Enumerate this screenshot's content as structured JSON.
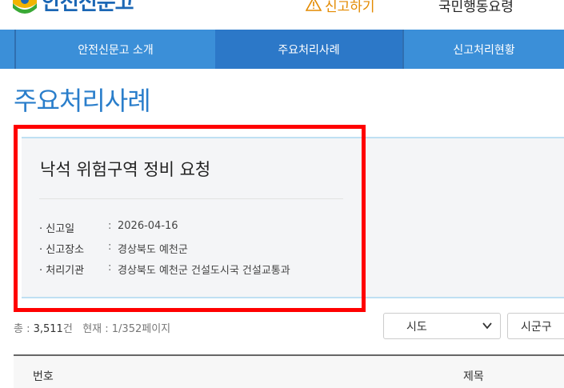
{
  "header": {
    "logo_text": "안전신문고",
    "report_label": "신고하기",
    "other_label": "국민행동요령"
  },
  "nav": {
    "items": [
      {
        "label": "안전신문고 소개"
      },
      {
        "label": "주요처리사례"
      },
      {
        "label": "신고처리현황"
      }
    ]
  },
  "page": {
    "title": "주요처리사례"
  },
  "case": {
    "title": "낙석 위험구역 정비 요청",
    "fields": [
      {
        "label": "· 신고일",
        "value": "2026-04-16"
      },
      {
        "label": "· 신고장소",
        "value": "경상북도 예천군"
      },
      {
        "label": "· 처리기관",
        "value": "경상북도 예천군 건설도시국 건설교통과"
      }
    ]
  },
  "summary": {
    "total_prefix": "총 : ",
    "total_value": "3,511",
    "total_suffix": "건",
    "current_prefix": "현재 : ",
    "current_value": "1/352",
    "current_suffix": "페이지"
  },
  "filters": {
    "sido": "시도",
    "sigungu": "시군구"
  },
  "table": {
    "headers": [
      "번호",
      "제목"
    ]
  },
  "colors": {
    "nav": "#3b8fd8",
    "accent_title": "#2a7ecb",
    "highlight": "#ff0000",
    "report": "#e38a00"
  }
}
